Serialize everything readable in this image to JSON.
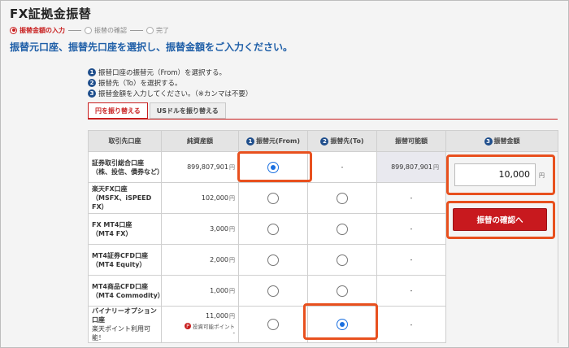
{
  "page": {
    "title": "FX証拠金振替",
    "subtitle": "振替元口座、振替先口座を選択し、振替金額をご入力ください。"
  },
  "steps": [
    {
      "label": "振替金額の入力",
      "active": true
    },
    {
      "label": "振替の確認",
      "active": false
    },
    {
      "label": "完了",
      "active": false
    }
  ],
  "instructions": [
    {
      "num": "1",
      "text": "振替口座の振替元（From）を選択する。"
    },
    {
      "num": "2",
      "text": "振替先（To）を選択する。"
    },
    {
      "num": "3",
      "text": "振替金額を入力してください。（※カンマは不要）"
    }
  ],
  "tabs": [
    {
      "label": "円を振り替える",
      "active": true
    },
    {
      "label": "USドルを振り替える",
      "active": false
    }
  ],
  "table": {
    "headers": {
      "account": "取引先口座",
      "balance": "純資産額",
      "from_num": "1",
      "from": "振替元(From)",
      "to_num": "2",
      "to": "振替先(To)",
      "available": "振替可能額",
      "amount_num": "3",
      "amount": "振替金額"
    },
    "rows": [
      {
        "name1": "証券取引総合口座",
        "name2": "（株、投信、債券など）",
        "balance": "899,807,901",
        "yen": "円",
        "from_checked": true,
        "to_text": "-",
        "available": "899,807,901",
        "available_yen": "円"
      },
      {
        "name1": "楽天FX口座",
        "name2": "（MSFX、iSPEED FX）",
        "balance": "102,000",
        "yen": "円",
        "from_checked": false,
        "to_checked": false,
        "available": "-"
      },
      {
        "name1": "FX MT4口座",
        "name2": "（MT4 FX）",
        "balance": "3,000",
        "yen": "円",
        "from_checked": false,
        "to_checked": false,
        "available": "-"
      },
      {
        "name1": "MT4証券CFD口座",
        "name2": "（MT4 Equity）",
        "balance": "2,000",
        "yen": "円",
        "from_checked": false,
        "to_checked": false,
        "available": "-"
      },
      {
        "name1": "MT4商品CFD口座",
        "name2": "（MT4 Commodity）",
        "balance": "1,000",
        "yen": "円",
        "from_checked": false,
        "to_checked": false,
        "available": "-"
      },
      {
        "name1": "バイナリーオプション口座",
        "name2": "楽天ポイント利用可能！",
        "balance": "11,000",
        "yen": "円",
        "points_note": "投資可能ポイント",
        "points_mark": "P",
        "points_suffix": "-",
        "from_checked": false,
        "to_checked": true,
        "available": "-"
      }
    ]
  },
  "amount_input": {
    "value": "10,000",
    "unit": "円"
  },
  "confirm_button": {
    "label": "振替の確認へ"
  },
  "colors": {
    "accent": "#c8191e",
    "title_blue": "#1f5fa8",
    "highlight": "#e8501e",
    "radio": "#1a6fe0"
  }
}
